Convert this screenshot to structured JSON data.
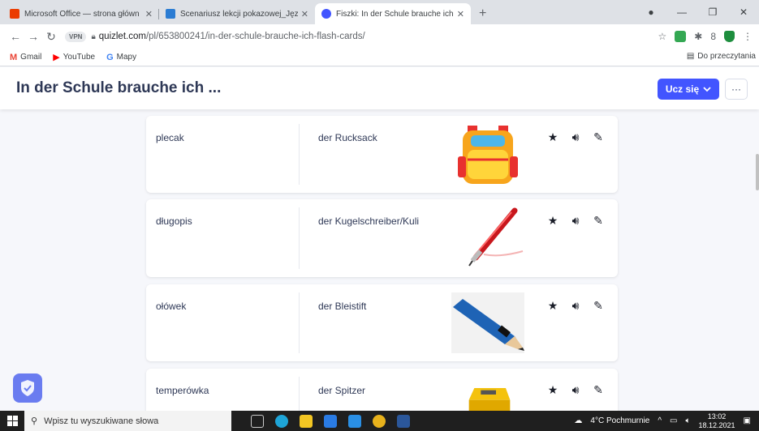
{
  "browser": {
    "tabs": [
      {
        "title": "Microsoft Office — strona główn",
        "favicon_color": "#eb3c00",
        "active": false
      },
      {
        "title": "Scenariusz lekcji pokazowej_Języ",
        "favicon_color": "#2b7cd3",
        "active": false
      },
      {
        "title": "Fiszki: In der Schule brauche ich",
        "favicon_color": "#4255ff",
        "active": true
      }
    ],
    "close_glyph": "✕",
    "new_tab_glyph": "+",
    "vpn_label": "VPN",
    "url_domain": "quizlet.com",
    "url_path": "/pl/653800241/in-der-schule-brauche-ich-flash-cards/",
    "bookmarks": [
      {
        "label": "Gmail",
        "icon": "M",
        "color": "#ea4335"
      },
      {
        "label": "YouTube",
        "icon": "▶",
        "color": "#ff0000"
      },
      {
        "label": "Mapy",
        "icon": "G",
        "color": "#4285f4"
      }
    ],
    "reading_list": "Do przeczytania"
  },
  "page": {
    "title": "In der Schule brauche ich ...",
    "learn_button": "Ucz się",
    "more_button": "···",
    "accent": "#4255ff"
  },
  "cards": [
    {
      "term": "plecak",
      "definition": "der Rucksack",
      "image": "backpack"
    },
    {
      "term": "długopis",
      "definition": "der Kugelschreiber/Kuli",
      "image": "pen"
    },
    {
      "term": "ołówek",
      "definition": "der Bleistift",
      "image": "pencil"
    },
    {
      "term": "temperówka",
      "definition": "der Spitzer",
      "image": "sharpener"
    }
  ],
  "taskbar": {
    "search_placeholder": "Wpisz tu wyszukiwane słowa",
    "weather": "4°C Pochmurnie",
    "time": "13:02",
    "date": "18.12.2021"
  }
}
